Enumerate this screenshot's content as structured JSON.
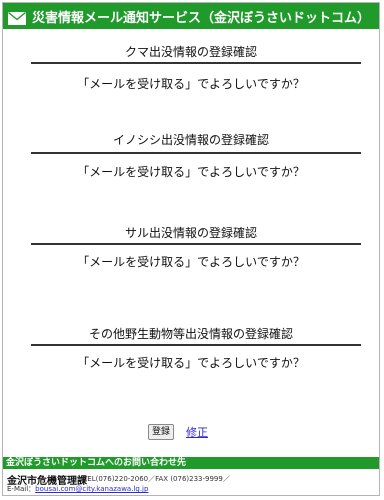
{
  "header": {
    "title": "災害情報メール通知サービス（金沢ぼうさいドットコム）",
    "icon": "mail-icon"
  },
  "sections": [
    {
      "title": "クマ出没情報の登録確認",
      "question": "「メールを受け取る」でよろしいですか？"
    },
    {
      "title": "イノシシ出没情報の登録確認",
      "question": "「メールを受け取る」でよろしいですか？"
    },
    {
      "title": "サル出没情報の登録確認",
      "question": "「メールを受け取る」でよろしいですか？"
    },
    {
      "title": "その他野生動物等出没情報の登録確認",
      "question": "「メールを受け取る」でよろしいですか？"
    }
  ],
  "actions": {
    "register_label": "登録",
    "edit_label": "修正"
  },
  "footer": {
    "bar_text": "金沢ぼうさいドットコムへのお問い合わせ先",
    "department": "金沢市危機管理課",
    "contact": "TEL(076)220-2060／FAX (076)233-9999／",
    "email_prefix": "E-Mail：",
    "email": "bousai.com@city.kanazawa.lg.jp"
  },
  "colors": {
    "brand_green": "#1f9a2b",
    "link_blue": "#2b2bd9"
  }
}
